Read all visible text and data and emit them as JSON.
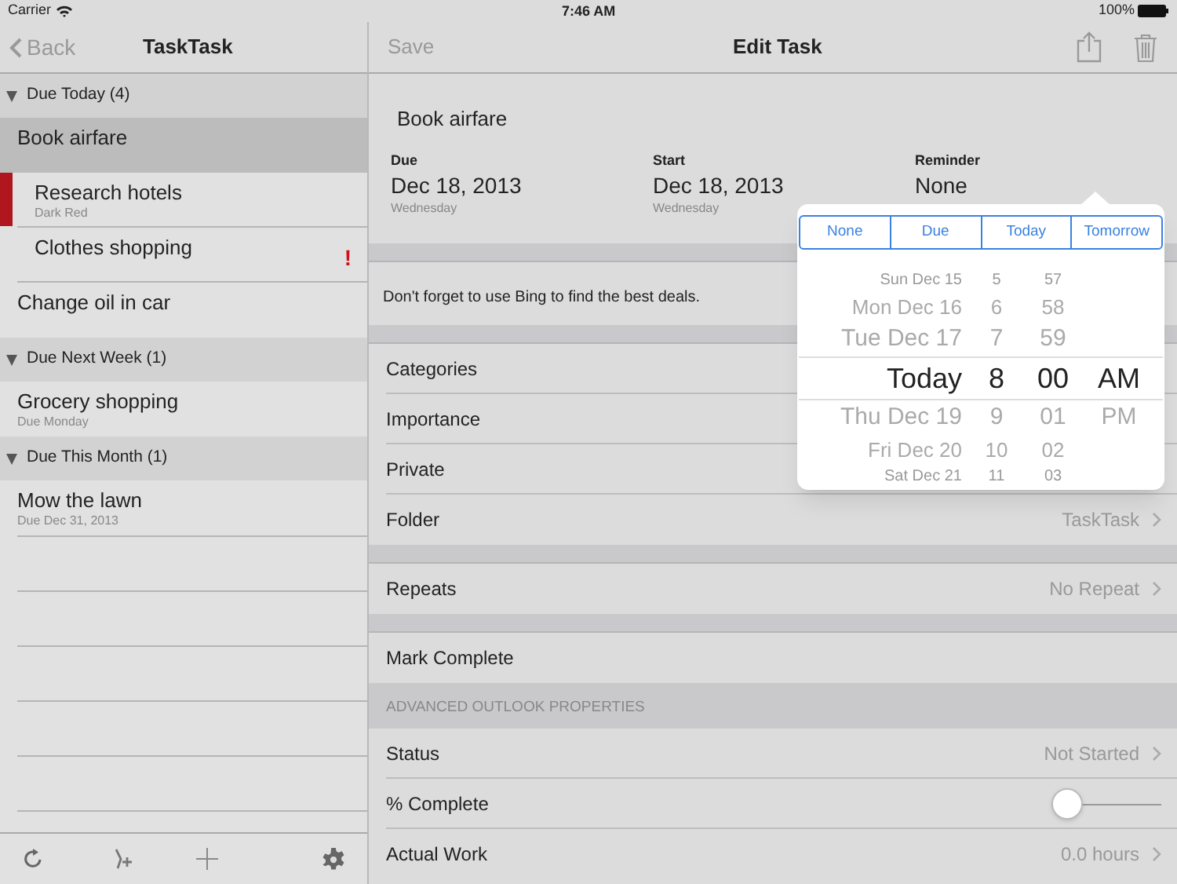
{
  "status_bar": {
    "carrier": "Carrier",
    "time": "7:46 AM",
    "battery": "100%"
  },
  "list_pane": {
    "back": "Back",
    "title": "TaskTask",
    "groups": [
      {
        "title": "Due Today (4)",
        "expanded": true,
        "tasks": [
          {
            "title": "Book airfare",
            "selected": true
          },
          {
            "title": "Research hotels",
            "subtitle": "Dark Red",
            "color": "#b0161e",
            "selected": false
          },
          {
            "title": "Clothes shopping",
            "selected": false,
            "flag": "!"
          },
          {
            "title": "Change oil in car",
            "selected": false
          }
        ]
      },
      {
        "title": "Due Next Week (1)",
        "expanded": true,
        "tasks": [
          {
            "title": "Grocery shopping",
            "subtitle": "Due Monday",
            "selected": false
          }
        ]
      },
      {
        "title": "Due This Month (1)",
        "expanded": true,
        "tasks": [
          {
            "title": "Mow the lawn",
            "subtitle": "Due Dec 31, 2013",
            "selected": false
          }
        ]
      }
    ]
  },
  "detail": {
    "save": "Save",
    "title": "Edit Task",
    "save_disabled": true,
    "task_title": "Book airfare",
    "dates": [
      {
        "label": "Due",
        "value": "Dec 18, 2013",
        "day": "Wednesday"
      },
      {
        "label": "Start",
        "value": "Dec 18, 2013",
        "day": "Wednesday"
      },
      {
        "label": "Reminder",
        "value": "None"
      }
    ],
    "notes": "Don't forget to use Bing to find the best deals.",
    "groups": [
      [
        {
          "label": "Categories"
        },
        {
          "label": "Importance"
        },
        {
          "label": "Private"
        },
        {
          "label": "Folder",
          "value": "TaskTask"
        }
      ],
      [
        {
          "label": "Repeats",
          "value": "No Repeat"
        }
      ],
      [
        {
          "label": "Mark Complete"
        }
      ]
    ],
    "advanced": {
      "header": "ADVANCED OUTLOOK PROPERTIES",
      "rows": [
        {
          "kind": "value",
          "label": "Status",
          "value": "Not Started"
        },
        {
          "kind": "slider",
          "label": "% Complete",
          "level": 0
        },
        {
          "kind": "value",
          "label": "Actual Work",
          "value": "0.0 hours"
        }
      ]
    }
  },
  "reminder_popover": {
    "options": [
      {
        "label": "None",
        "selected": false
      },
      {
        "label": "Due",
        "selected": false
      },
      {
        "label": "Today",
        "selected": false
      },
      {
        "label": "Tomorrow",
        "selected": false
      }
    ],
    "picker_rows": [
      {
        "day": "Sun Dec 15",
        "hour": "5",
        "minute": "57",
        "selected": false
      },
      {
        "day": "Mon Dec 16",
        "hour": "6",
        "minute": "58",
        "selected": false
      },
      {
        "day": "Tue Dec 17",
        "hour": "7",
        "minute": "59",
        "selected": false
      },
      {
        "day": "Today",
        "hour": "8",
        "minute": "00",
        "period": "AM",
        "selected": true
      },
      {
        "day": "Thu Dec 19",
        "hour": "9",
        "minute": "01",
        "period": "PM",
        "selected": false
      },
      {
        "day": "Fri Dec 20",
        "hour": "10",
        "minute": "02",
        "selected": false
      },
      {
        "day": "Sat Dec 21",
        "hour": "11",
        "minute": "03",
        "selected": false
      }
    ]
  }
}
